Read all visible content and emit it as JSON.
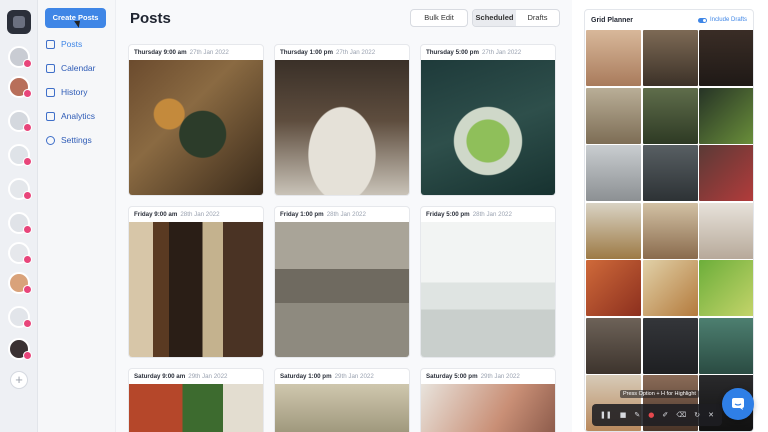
{
  "nav": {
    "create_label": "Create Posts",
    "items": [
      {
        "label": "Posts",
        "icon": "grid-icon"
      },
      {
        "label": "Calendar",
        "icon": "calendar-icon"
      },
      {
        "label": "History",
        "icon": "history-icon"
      },
      {
        "label": "Analytics",
        "icon": "analytics-icon"
      },
      {
        "label": "Settings",
        "icon": "gear-icon"
      }
    ]
  },
  "header": {
    "title": "Posts",
    "bulk_edit": "Bulk Edit",
    "tab_scheduled": "Scheduled",
    "tab_drafts": "Drafts"
  },
  "posts": [
    {
      "day": "Thursday 9:00 am",
      "date": "27th Jan 2022"
    },
    {
      "day": "Thursday 1:00 pm",
      "date": "27th Jan 2022"
    },
    {
      "day": "Thursday 5:00 pm",
      "date": "27th Jan 2022"
    },
    {
      "day": "Friday 9:00 am",
      "date": "28th Jan 2022"
    },
    {
      "day": "Friday 1:00 pm",
      "date": "28th Jan 2022"
    },
    {
      "day": "Friday 5:00 pm",
      "date": "28th Jan 2022"
    },
    {
      "day": "Saturday 9:00 am",
      "date": "29th Jan 2022"
    },
    {
      "day": "Saturday 1:00 pm",
      "date": "29th Jan 2022"
    },
    {
      "day": "Saturday 5:00 pm",
      "date": "29th Jan 2022"
    }
  ],
  "planner": {
    "title": "Grid Planner",
    "include_drafts": "Include Drafts"
  },
  "recorder": {
    "hint": "Press Option + H for Highlight"
  },
  "colors": {
    "accent": "#3f86e6",
    "notification": "#e8457a"
  }
}
